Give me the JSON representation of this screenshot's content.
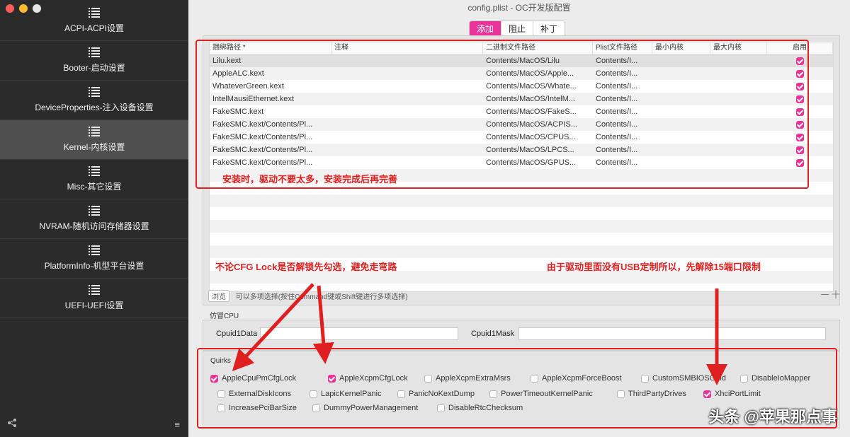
{
  "window": {
    "title": "config.plist - OC开发版配置"
  },
  "sidebar": {
    "items": [
      {
        "label": "ACPI-ACPI设置",
        "active": false
      },
      {
        "label": "Booter-启动设置",
        "active": false
      },
      {
        "label": "DeviceProperties-注入设备设置",
        "active": false
      },
      {
        "label": "Kernel-内核设置",
        "active": true
      },
      {
        "label": "Misc-其它设置",
        "active": false
      },
      {
        "label": "NVRAM-随机访问存储器设置",
        "active": false
      },
      {
        "label": "PlatformInfo-机型平台设置",
        "active": false
      },
      {
        "label": "UEFI-UEFI设置",
        "active": false
      }
    ],
    "footer_left": "share-icon",
    "footer_right": "≡"
  },
  "tabs": [
    {
      "label": "添加",
      "active": true
    },
    {
      "label": "阻止",
      "active": false
    },
    {
      "label": "补丁",
      "active": false
    }
  ],
  "kext_table": {
    "headers": [
      "捆绑路径 *",
      "注释",
      "二进制文件路径",
      "Plist文件路径",
      "最小内核",
      "最大内核",
      "启用"
    ],
    "rows": [
      {
        "bundle": "Lilu.kext",
        "comment": "",
        "exec": "Contents/MacOS/Lilu",
        "plist": "Contents/I...",
        "min": "",
        "max": "",
        "enabled": true
      },
      {
        "bundle": "AppleALC.kext",
        "comment": "",
        "exec": "Contents/MacOS/Apple...",
        "plist": "Contents/I...",
        "min": "",
        "max": "",
        "enabled": true
      },
      {
        "bundle": "WhateverGreen.kext",
        "comment": "",
        "exec": "Contents/MacOS/Whate...",
        "plist": "Contents/I...",
        "min": "",
        "max": "",
        "enabled": true
      },
      {
        "bundle": "IntelMausiEthernet.kext",
        "comment": "",
        "exec": "Contents/MacOS/IntelM...",
        "plist": "Contents/I...",
        "min": "",
        "max": "",
        "enabled": true
      },
      {
        "bundle": "FakeSMC.kext",
        "comment": "",
        "exec": "Contents/MacOS/FakeS...",
        "plist": "Contents/I...",
        "min": "",
        "max": "",
        "enabled": true
      },
      {
        "bundle": "FakeSMC.kext/Contents/Pl...",
        "comment": "",
        "exec": "Contents/MacOS/ACPIS...",
        "plist": "Contents/I...",
        "min": "",
        "max": "",
        "enabled": true
      },
      {
        "bundle": "FakeSMC.kext/Contents/Pl...",
        "comment": "",
        "exec": "Contents/MacOS/CPUS...",
        "plist": "Contents/I...",
        "min": "",
        "max": "",
        "enabled": true
      },
      {
        "bundle": "FakeSMC.kext/Contents/Pl...",
        "comment": "",
        "exec": "Contents/MacOS/LPCS...",
        "plist": "Contents/I...",
        "min": "",
        "max": "",
        "enabled": true
      },
      {
        "bundle": "FakeSMC.kext/Contents/Pl...",
        "comment": "",
        "exec": "Contents/MacOS/GPUS...",
        "plist": "Contents/I...",
        "min": "",
        "max": "",
        "enabled": true
      }
    ],
    "footer_button": "浏览",
    "footer_text": "可以多项选择(按住Command键或Shift键进行多项选择)",
    "add_remove": "一 十"
  },
  "cpu": {
    "section_label": "仿冒CPU",
    "cpuid_data_label": "Cpuid1Data",
    "cpuid_data_value": "",
    "cpuid_mask_label": "Cpuid1Mask",
    "cpuid_mask_value": ""
  },
  "quirks": {
    "section_label": "Quirks",
    "items": [
      {
        "label": "AppleCpuPmCfgLock",
        "checked": true
      },
      {
        "label": "AppleXcpmCfgLock",
        "checked": true
      },
      {
        "label": "AppleXcpmExtraMsrs",
        "checked": false
      },
      {
        "label": "AppleXcpmForceBoost",
        "checked": false
      },
      {
        "label": "CustomSMBIOSGuid",
        "checked": false
      },
      {
        "label": "DisableIoMapper",
        "checked": false
      },
      {
        "label": "ExternalDiskIcons",
        "checked": false
      },
      {
        "label": "LapicKernelPanic",
        "checked": false
      },
      {
        "label": "PanicNoKextDump",
        "checked": false
      },
      {
        "label": "PowerTimeoutKernelPanic",
        "checked": false
      },
      {
        "label": "ThirdPartyDrives",
        "checked": false
      },
      {
        "label": "XhciPortLimit",
        "checked": true
      },
      {
        "label": "IncreasePciBarSize",
        "checked": false
      },
      {
        "label": "DummyPowerManagement",
        "checked": false
      },
      {
        "label": "DisableRtcChecksum",
        "checked": false
      }
    ]
  },
  "annotations": {
    "kext_note": "安装时，驱动不要太多，安装完成后再完善",
    "cfg_note": "不论CFG Lock是否解锁先勾选，避免走弯路",
    "usb_note": "由于驱动里面没有USB定制所以，先解除15端口限制",
    "watermark": "头条 @苹果那点事"
  },
  "colors": {
    "accent": "#e7339a",
    "annotation": "#e02020",
    "sidebar_bg": "#2b2b2b"
  }
}
